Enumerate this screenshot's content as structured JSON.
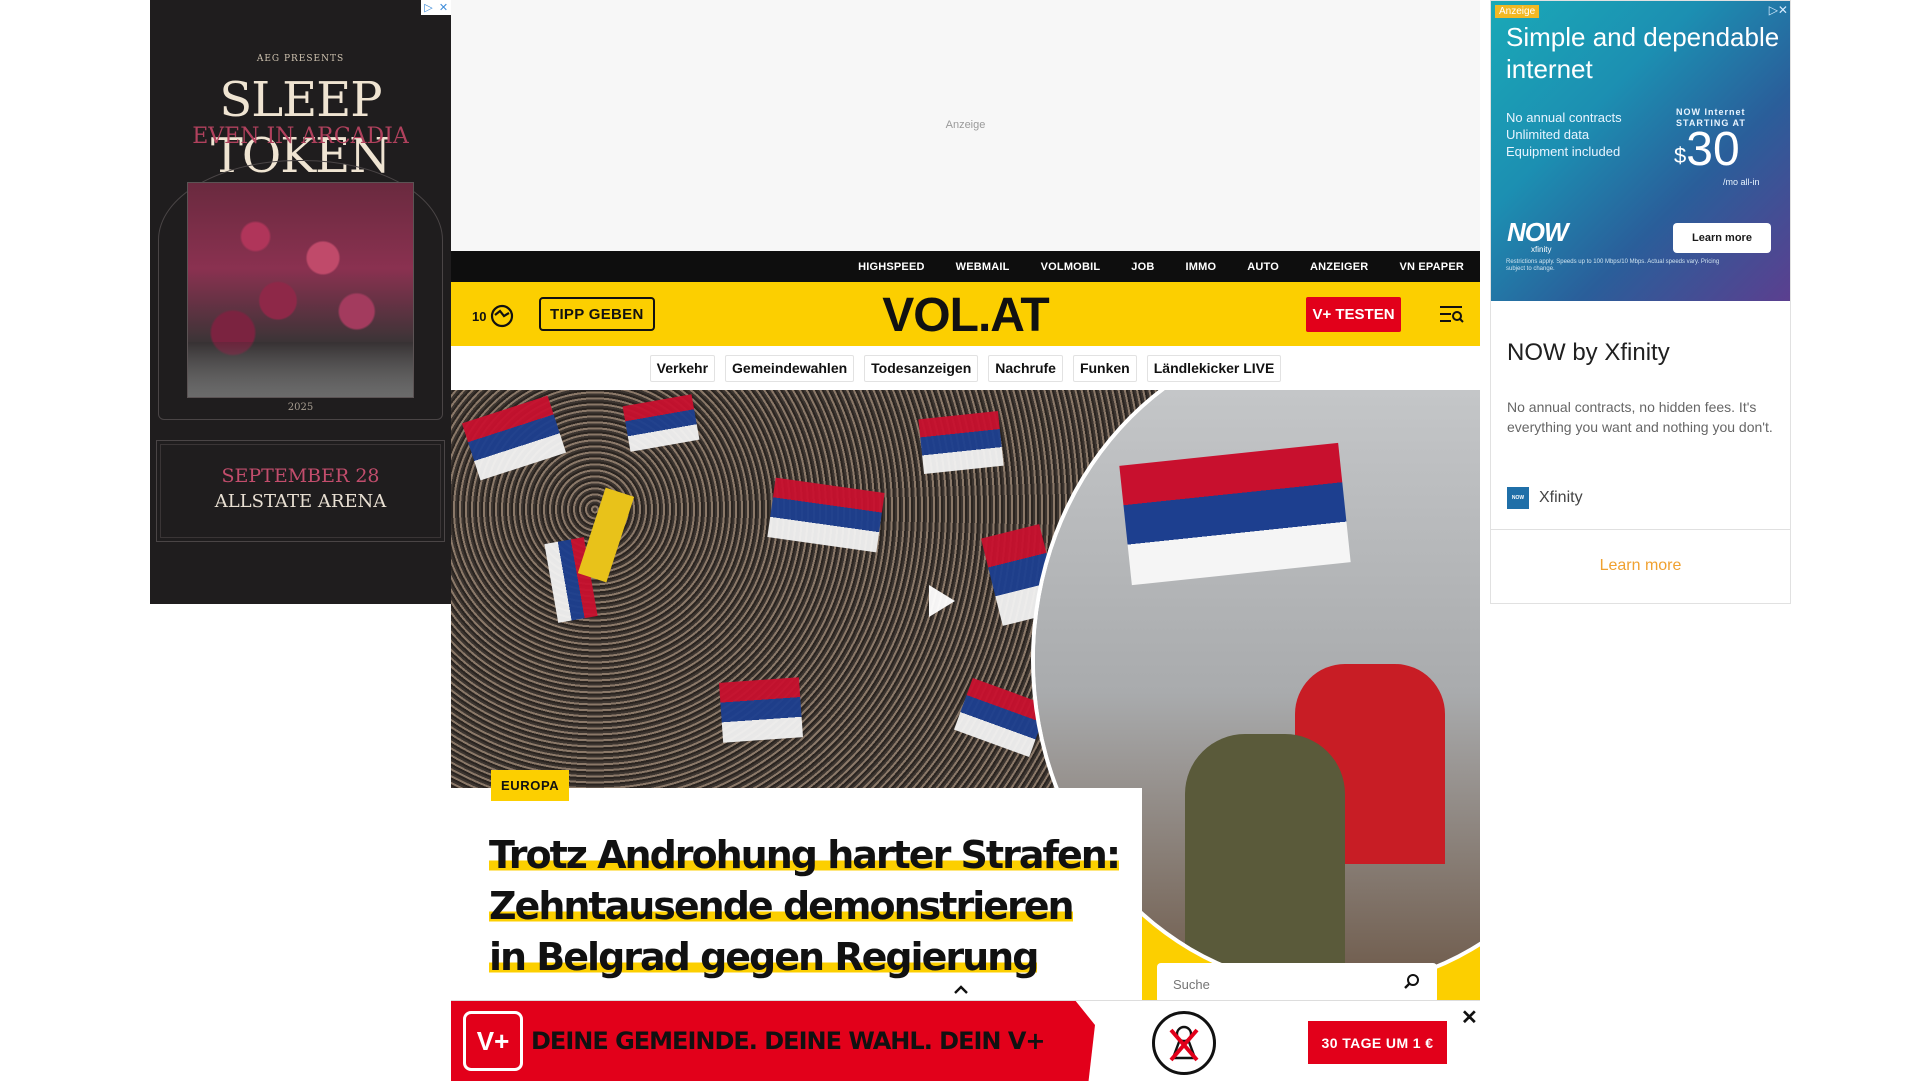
{
  "ad_left": {
    "presents": "AEG PRESENTS",
    "band": "SLEEP TOKEN",
    "tour": "EVEN IN ARCADIA",
    "year": "2025",
    "date": "SEPTEMBER 28",
    "venue": "ALLSTATE ARENA",
    "adchoices_icon": "adchoices-icon",
    "close_icon": "close-icon"
  },
  "ad_top": {
    "label": "Anzeige"
  },
  "ad_right": {
    "tag": "Anzeige",
    "headline": "Simple and dependable internet",
    "bullets": [
      "No annual contracts",
      "Unlimited data",
      "Equipment included"
    ],
    "price_label_1": "NOW Internet",
    "price_label_2": "STARTING AT",
    "price_currency": "$",
    "price_value": "30",
    "price_suffix": "/mo all-in",
    "logo_text": "NOW",
    "logo_sub": "xfinity",
    "creative_button": "Learn more",
    "fine_print": "Restrictions apply. Speeds up to 100 Mbps/10 Mbps. Actual speeds vary. Pricing subject to change.",
    "title": "NOW by Xfinity",
    "description": "No annual contracts, no hidden fees. It's everything you want and nothing you don't.",
    "advertiser": "Xfinity",
    "advertiser_logo": "NOW",
    "cta": "Learn more",
    "colors": {
      "cta": "#f0a130"
    }
  },
  "topnav": [
    "HIGHSPEED",
    "WEBMAIL",
    "VOLMOBIL",
    "JOB",
    "IMMO",
    "AUTO",
    "ANZEIGER",
    "VN EPAPER"
  ],
  "header": {
    "temperature": "10",
    "weather_icon": "cloud-sun-icon",
    "tipp_label": "TIPP GEBEN",
    "logo": "VOL.AT",
    "vplus_label": "V+ TESTEN",
    "menu_icon": "menu-search-icon",
    "colors": {
      "brand_yellow": "#fccf00",
      "brand_red": "#e2001a"
    }
  },
  "tags": [
    "Verkehr",
    "Gemeindewahlen",
    "Todesanzeigen",
    "Nachrufe",
    "Funken",
    "Ländlekicker LIVE"
  ],
  "hero": {
    "kicker": "EUROPA",
    "headline_lines": [
      "Trotz Androhung harter Strafen:",
      "Zehntausende demonstrieren",
      "in Belgrad gegen Regierung"
    ],
    "play_icon": "play-icon"
  },
  "search": {
    "placeholder": "Suche",
    "icon": "search-icon"
  },
  "banner": {
    "logo": "V+",
    "slogan": "DEINE GEMEINDE. DEINE WAHL. DEIN V+",
    "cta": "30 TAGE UM 1 €",
    "close": "✕",
    "stamp_icon": "ballot-stamp-icon"
  }
}
